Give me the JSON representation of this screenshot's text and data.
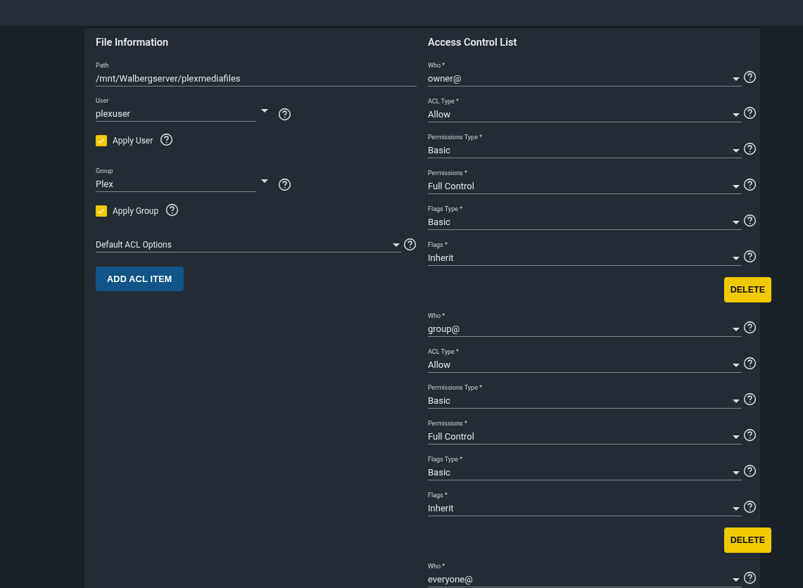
{
  "file_information": {
    "title": "File Information",
    "items": [
      {
        "kind": "text",
        "label": "Path",
        "value": "/mnt/Walbergserver/plexmediafiles"
      },
      {
        "kind": "select",
        "label": "User",
        "value": "plexuser"
      },
      {
        "kind": "checkbox",
        "label": "Apply User",
        "checked": true
      },
      {
        "kind": "select",
        "label": "Group",
        "value": "Plex"
      },
      {
        "kind": "checkbox",
        "label": "Apply Group",
        "checked": true
      },
      {
        "kind": "dropdown",
        "placeholder": "Default ACL Options"
      }
    ],
    "add_button": "ADD ACL ITEM"
  },
  "access_control_list": {
    "title": "Access Control List",
    "entries": [
      {
        "fields": [
          {
            "label": "Who *",
            "value": "owner@"
          },
          {
            "label": "ACL Type *",
            "value": "Allow"
          },
          {
            "label": "Permissions Type *",
            "value": "Basic"
          },
          {
            "label": "Permissions *",
            "value": "Full Control"
          },
          {
            "label": "Flags Type *",
            "value": "Basic"
          },
          {
            "label": "Flags *",
            "value": "Inherit"
          }
        ],
        "delete_button": "DELETE"
      },
      {
        "fields": [
          {
            "label": "Who *",
            "value": "group@"
          },
          {
            "label": "ACL Type *",
            "value": "Allow"
          },
          {
            "label": "Permissions Type *",
            "value": "Basic"
          },
          {
            "label": "Permissions *",
            "value": "Full Control"
          },
          {
            "label": "Flags Type *",
            "value": "Basic"
          },
          {
            "label": "Flags *",
            "value": "Inherit"
          }
        ],
        "delete_button": "DELETE"
      },
      {
        "fields": [
          {
            "label": "Who *",
            "value": "everyone@"
          }
        ]
      }
    ]
  }
}
